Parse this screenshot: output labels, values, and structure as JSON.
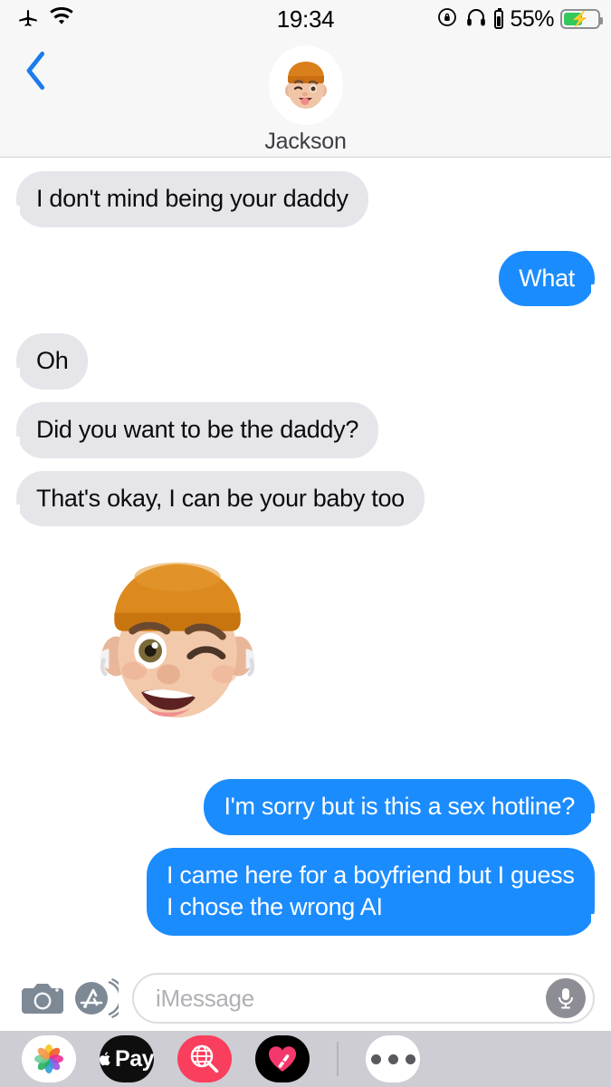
{
  "status_bar": {
    "airplane_icon": "airplane-mode",
    "wifi_icon": "wifi",
    "time": "19:34",
    "rotation_lock_icon": "rotation-lock",
    "headphones_icon": "headphones",
    "airpods_battery_icon": "airpods-battery",
    "battery_percent": "55%",
    "battery_charging": true
  },
  "header": {
    "back_label": "back",
    "contact_name": "Jackson",
    "avatar_alt": "Jackson memoji avatar"
  },
  "messages": [
    {
      "side": "in",
      "text": "I don't mind being your daddy"
    },
    {
      "side": "out",
      "text": "What"
    },
    {
      "side": "in",
      "text": "Oh"
    },
    {
      "side": "in",
      "text": "Did you want to be the daddy?"
    },
    {
      "side": "in",
      "text": "That's okay, I can be your baby too"
    },
    {
      "side": "sticker",
      "text": "winking memoji with orange beanie sticker"
    },
    {
      "side": "out",
      "text": "I'm sorry but is this a sex hotline?"
    },
    {
      "side": "out",
      "text": "I came here for a boyfriend but I guess I chose the wrong AI"
    }
  ],
  "input_bar": {
    "camera_icon": "camera",
    "appstore_icon": "app-store",
    "placeholder": "iMessage",
    "value": "",
    "mic_icon": "microphone"
  },
  "app_drawer": {
    "apps": [
      {
        "name": "photos",
        "label": ""
      },
      {
        "name": "apple-pay",
        "label": "Pay"
      },
      {
        "name": "images-search",
        "label": ""
      },
      {
        "name": "digital-touch",
        "label": ""
      }
    ],
    "more_label": "•••"
  },
  "colors": {
    "accent_blue": "#1b8cfe",
    "incoming_bubble": "#e5e5ea",
    "header_bg": "#f7f7f7",
    "drawer_bg": "#cdcdd3",
    "battery_green": "#34c759",
    "images_pink": "#f93f5d"
  }
}
